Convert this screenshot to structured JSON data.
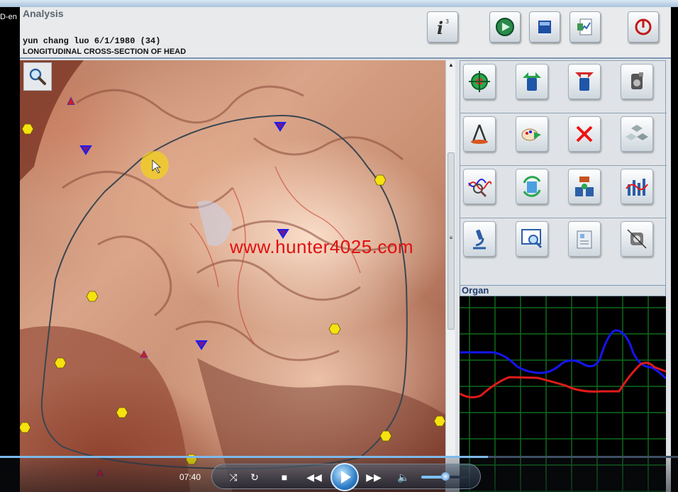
{
  "side_tag": "D-en",
  "header": {
    "app_title": "Analysis",
    "patient": "yun chang luo 6/1/1980 (34)",
    "section": "LONGITUDINAL CROSS-SECTION OF HEAD",
    "buttons": [
      {
        "name": "info-button",
        "icon": "info-icon"
      },
      {
        "name": "play-analysis-button",
        "icon": "play-circle-icon"
      },
      {
        "name": "book-button",
        "icon": "book-icon"
      },
      {
        "name": "report-button",
        "icon": "document-chart-icon"
      },
      {
        "name": "power-button",
        "icon": "power-icon"
      }
    ]
  },
  "viewer": {
    "watermark": "www.hunter4025.com",
    "zoom_icon": "magnifier-icon"
  },
  "tools": [
    [
      "target-icon",
      "export-arrow-icon",
      "import-arrow-icon",
      "container-icon"
    ],
    [
      "compass-icon",
      "palette-arrow-icon",
      "close-x-icon",
      "cubes-icon"
    ],
    [
      "wave-search-icon",
      "refresh-cycle-icon",
      "exchange-icon",
      "chart-bars-icon"
    ],
    [
      "microscope-icon",
      "magnify-window-icon",
      "clipboard-icon",
      "device-icon"
    ]
  ],
  "organ_panel": {
    "label": "Organ",
    "colors": {
      "series_a": "#1515ee",
      "series_b": "#e21a1a",
      "grid": "#0e6b1c"
    }
  },
  "media": {
    "time": "07:40",
    "progress": 0.72,
    "volume": 0.52
  }
}
